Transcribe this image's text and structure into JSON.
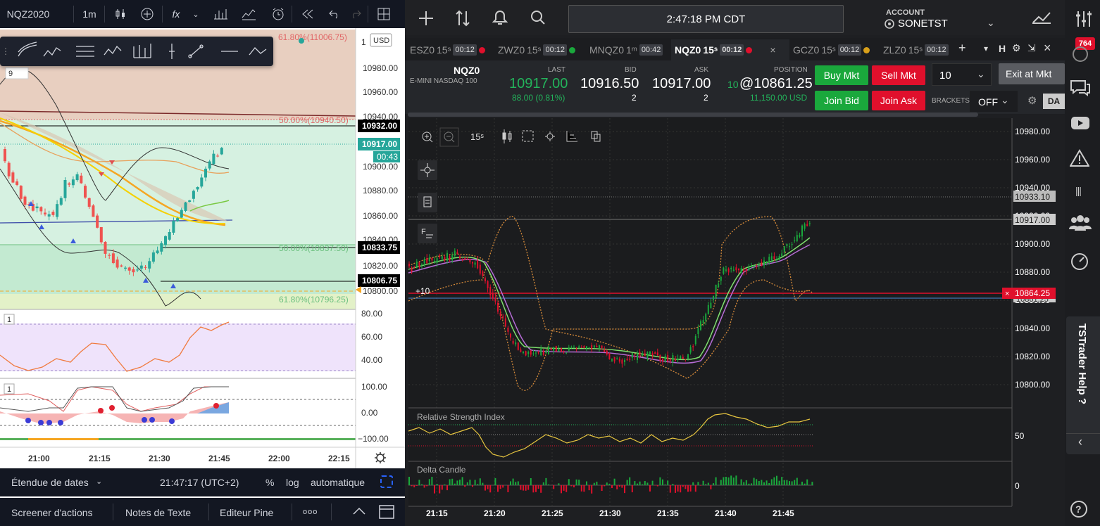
{
  "tv": {
    "symbol": "NQZ2020",
    "interval": "1m",
    "fx": "fx",
    "usd": "USD",
    "legend_count": "9",
    "pane_num1": "1",
    "pane_num2": "1",
    "fib_top": "61.80%(11006.75)",
    "fib50a": "50.00%(10940.50)",
    "fib50b": "50.00%(10837.50)",
    "fib618": "61.80%(10796.25)",
    "price_axis": [
      "1",
      "10980.00",
      "10960.00",
      "10940.00",
      "10900.00",
      "10880.00",
      "10860.00",
      "10840.00",
      "10820.00",
      "10800.00"
    ],
    "tags": {
      "t1": "10932.00",
      "t2": "10917.00",
      "t3": "00:43",
      "t4": "10833.75",
      "t5": "10806.75"
    },
    "rsi_axis": [
      "80.00",
      "60.00",
      "40.00"
    ],
    "osc_axis": [
      "100.00",
      "0.00",
      "−100.00"
    ],
    "time_axis": [
      "21:00",
      "21:15",
      "21:30",
      "21:45",
      "22:00",
      "22:15"
    ],
    "date_range": "Étendue de dates",
    "clock": "21:47:17 (UTC+2)",
    "pct": "%",
    "log": "log",
    "auto": "automatique",
    "bottom_tabs": [
      "Screener d'actions",
      "Notes de Texte",
      "Editeur Pine",
      "ooo"
    ]
  },
  "ts": {
    "time": "2:47:18 PM CDT",
    "account_label": "ACCOUNT",
    "account": "SONETST",
    "tabs": [
      {
        "name": "ESZ0",
        "sup": "15ˢ",
        "cnt": "00:12",
        "dot": "#e0102c"
      },
      {
        "name": "ZWZ0",
        "sup": "15ˢ",
        "cnt": "00:12",
        "dot": "#1aa83c"
      },
      {
        "name": "MNQZ0",
        "sup": "1ᵐ",
        "cnt": "00:42",
        "dot": ""
      },
      {
        "name": "NQZ0",
        "sup": "15ˢ",
        "cnt": "00:12",
        "dot": "#e0102c"
      },
      {
        "name": "GCZ0",
        "sup": "15ˢ",
        "cnt": "00:12",
        "dot": "#d9a01a"
      },
      {
        "name": "ZLZ0",
        "sup": "15ˢ",
        "cnt": "00:12",
        "dot": ""
      }
    ],
    "tab_close": "×",
    "tab_plus": "+",
    "tab_icons": [
      "▾",
      "H",
      "⚙",
      "⇲",
      "×"
    ],
    "symbol": "NQZ0",
    "desc": "E-MINI NASDAQ 100",
    "last_label": "LAST",
    "last": "10917.00",
    "change": "88.00 (0.81%)",
    "bid_label": "BID",
    "bid": "10916.50",
    "bid_size": "2",
    "ask_label": "ASK",
    "ask": "10917.00",
    "ask_size": "2",
    "pos_label": "POSITION",
    "pos_qty": "10",
    "pos_price": "@10861.25",
    "pos_usd": "11,150.00 USD",
    "buy": "Buy Mkt",
    "sell": "Sell Mkt",
    "join_bid": "Join Bid",
    "join_ask": "Join Ask",
    "qty": "10",
    "exit": "Exit at Mkt",
    "brackets_label": "BRACKETS",
    "brackets": "OFF",
    "da": "DA",
    "chart_interval": "15ˢ",
    "price_axis": [
      "10980.00",
      "10960.00",
      "10940.00",
      "10920.00",
      "10900.00",
      "10880.00",
      "10860.00",
      "10840.00",
      "10820.00",
      "10800.00"
    ],
    "tag_top": "10933.10",
    "tag_last": "10917.00",
    "tag_pos": "10864.25",
    "tag_under": "10861.25",
    "pos_marker": "+10",
    "rsi_title": "Relative Strength Index",
    "rsi_axis": "50",
    "delta_title": "Delta Candle",
    "delta_axis": "0",
    "time_axis": [
      "21:15",
      "21:20",
      "21:25",
      "21:30",
      "21:35",
      "21:40",
      "21:45"
    ],
    "badge": "764",
    "help": "TSTrader Help ?"
  }
}
